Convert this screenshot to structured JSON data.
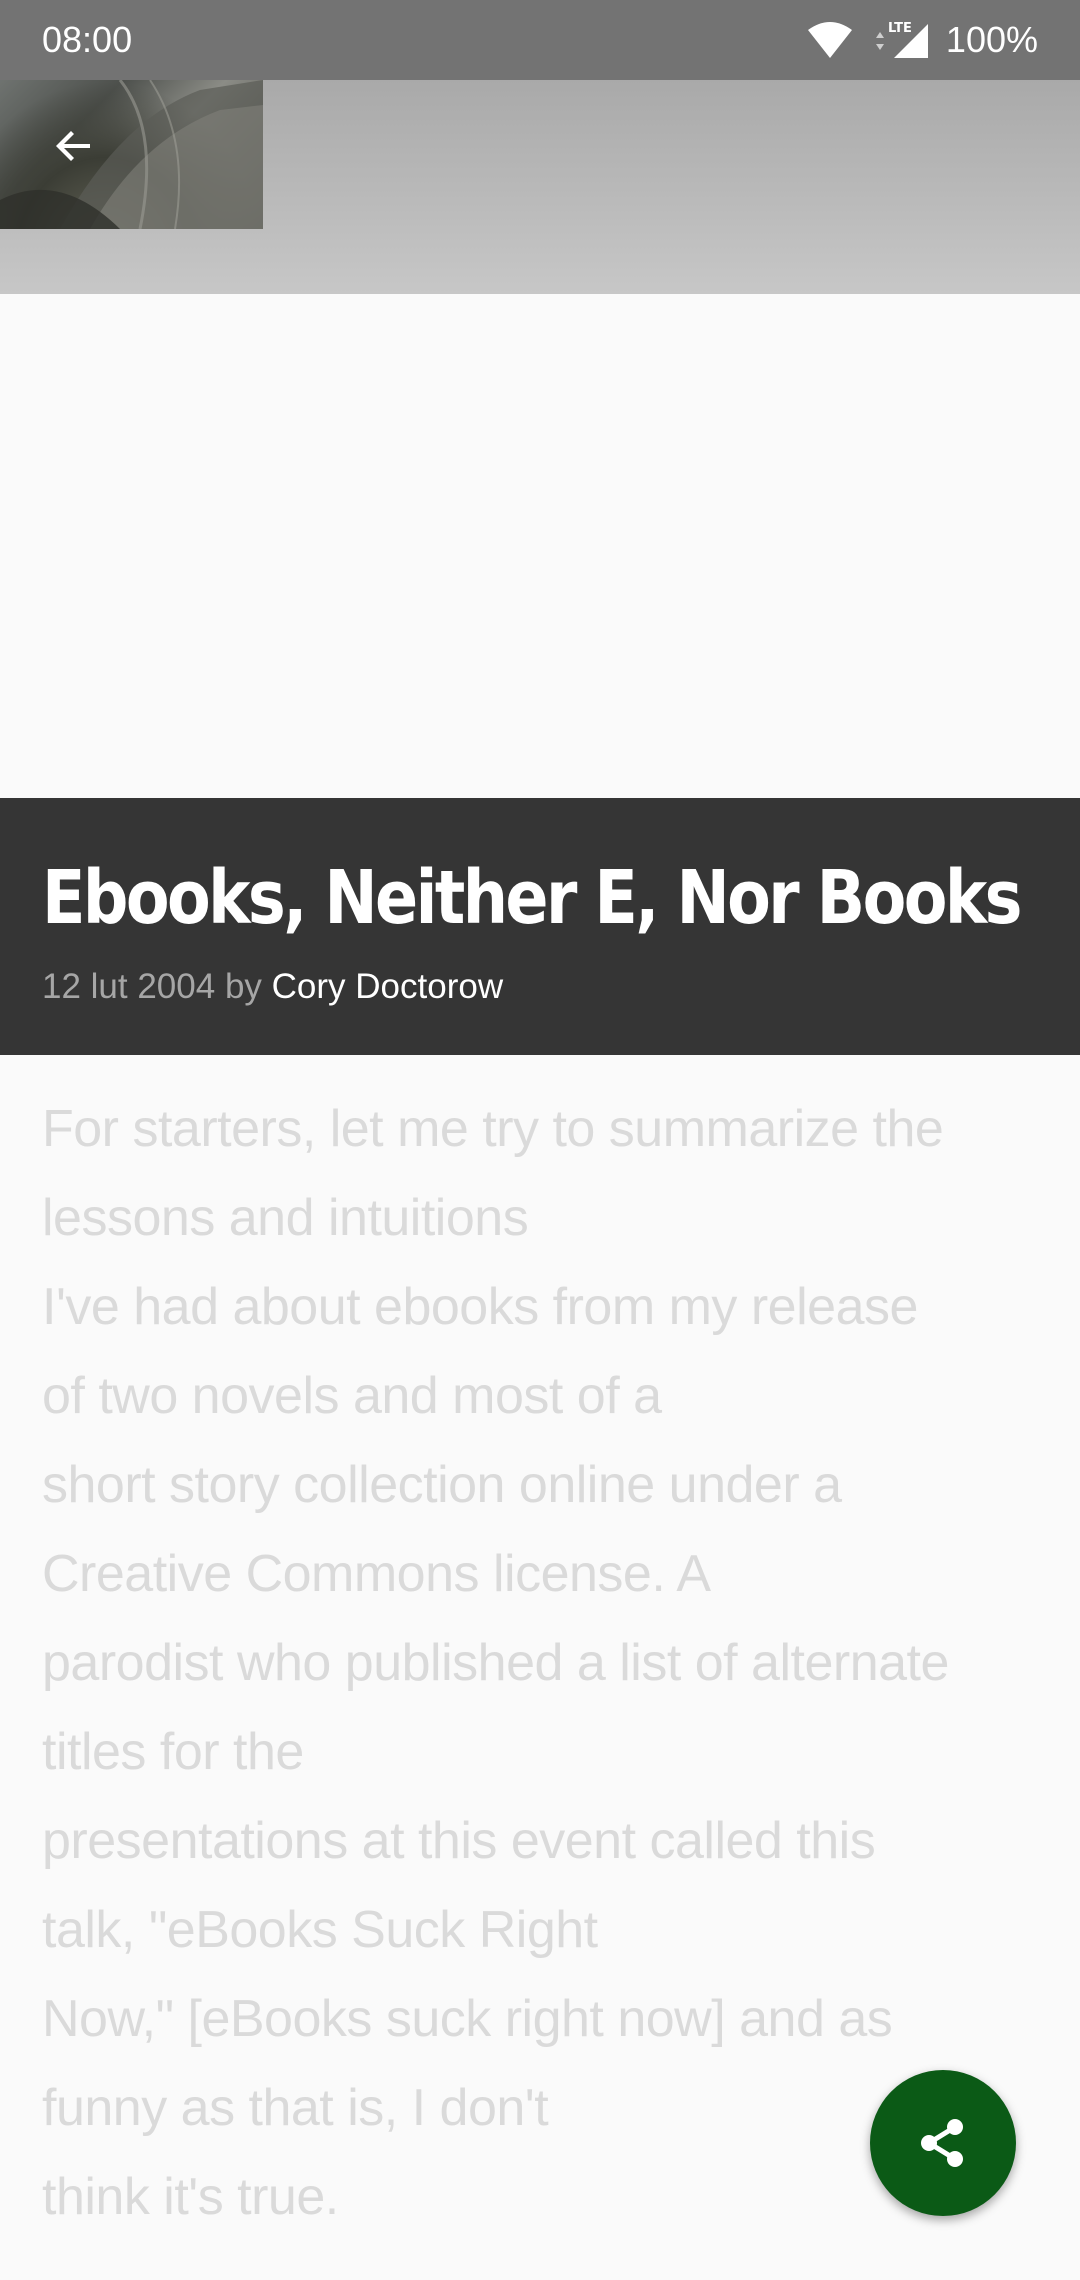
{
  "status_bar": {
    "time": "08:00",
    "network": "LTE",
    "battery": "100%",
    "icons": [
      "wifi-icon",
      "lte-signal-icon"
    ]
  },
  "header": {
    "back_icon": "arrow-back-icon",
    "cover_image": "book-cover-thumbnail"
  },
  "article": {
    "title": "Ebooks, Neither E, Nor Books",
    "date": "12 lut 2004",
    "by": "by",
    "author": "Cory Doctorow",
    "body_lines": [
      "For starters, let me try to summarize the",
      "lessons and intuitions",
      "I've had about ebooks from my release",
      "of two novels and most of a",
      "short story collection online under a",
      "Creative Commons license. A",
      "parodist who published a list of alternate",
      "titles for the",
      "presentations at this event called this",
      "talk, \"eBooks Suck Right",
      "Now,\" [eBooks suck right now] and as",
      "funny as that is, I don't",
      "think it's true."
    ]
  },
  "fab": {
    "icon": "share-icon",
    "color": "#0b5a16"
  },
  "colors": {
    "status_bar": "#737373",
    "title_panel": "#353535",
    "body_text": "#dadada",
    "background": "#fafafa"
  }
}
